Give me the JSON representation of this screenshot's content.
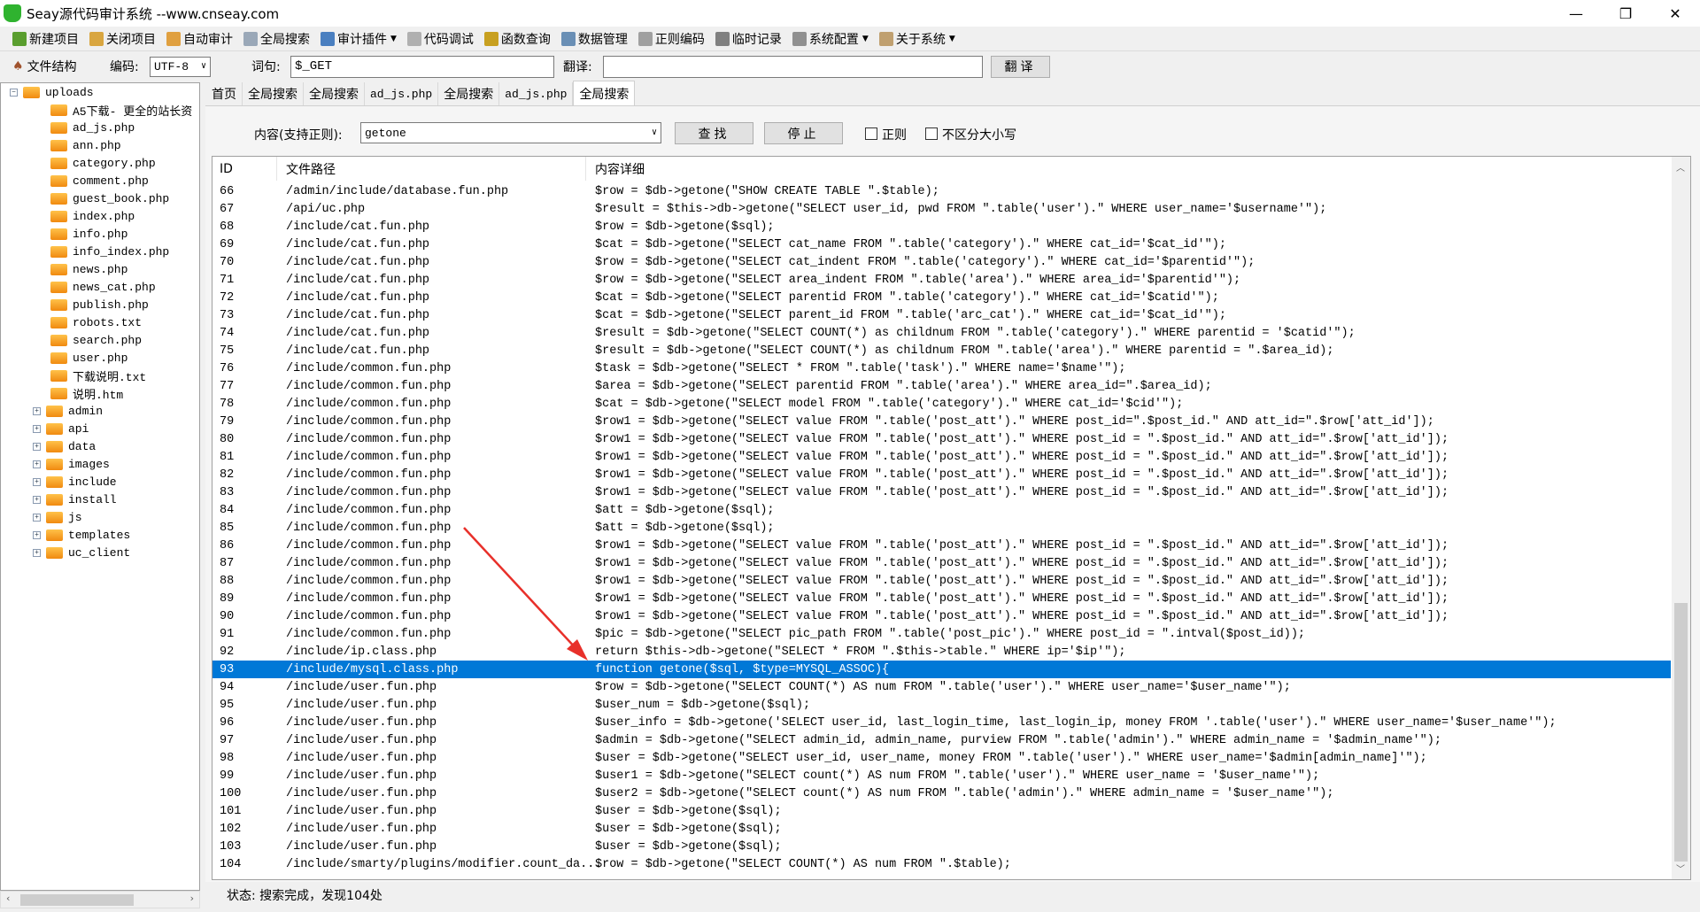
{
  "window": {
    "title": "Seay源代码审计系统 --www.cnseay.com",
    "minimize": "—",
    "maximize": "❐",
    "close": "✕"
  },
  "toolbar": [
    {
      "label": "新建项目",
      "icon": "new-project-icon",
      "color": "#5a9e2f"
    },
    {
      "label": "关闭项目",
      "icon": "close-project-icon",
      "color": "#d9a640"
    },
    {
      "label": "自动审计",
      "icon": "auto-audit-icon",
      "color": "#e0a040"
    },
    {
      "label": "全局搜索",
      "icon": "search-icon",
      "color": "#9aa8b8"
    },
    {
      "label": "审计插件",
      "icon": "plugin-icon",
      "color": "#4a7fc0",
      "dropdown": true
    },
    {
      "label": "代码调试",
      "icon": "debug-icon",
      "color": "#b0b0b0"
    },
    {
      "label": "函数查询",
      "icon": "function-search-icon",
      "color": "#c8a020"
    },
    {
      "label": "数据管理",
      "icon": "data-manage-icon",
      "color": "#6a8fb5"
    },
    {
      "label": "正则编码",
      "icon": "regex-icon",
      "color": "#a0a0a0"
    },
    {
      "label": "临时记录",
      "icon": "notes-icon",
      "color": "#808080"
    },
    {
      "label": "系统配置",
      "icon": "gear-icon",
      "color": "#909090",
      "dropdown": true
    },
    {
      "label": "关于系统",
      "icon": "about-icon",
      "color": "#c0a070",
      "dropdown": true
    }
  ],
  "row2": {
    "file_structure": "文件结构",
    "encoding_label": "编码:",
    "encoding_value": "UTF-8",
    "word_label": "词句:",
    "word_value": "$_GET",
    "translate_label": "翻译:",
    "translate_value": "",
    "translate_button": "翻译"
  },
  "tree": {
    "root": "uploads",
    "files": [
      "A5下载- 更全的站长资",
      "ad_js.php",
      "ann.php",
      "category.php",
      "comment.php",
      "guest_book.php",
      "index.php",
      "info.php",
      "info_index.php",
      "news.php",
      "news_cat.php",
      "publish.php",
      "robots.txt",
      "search.php",
      "user.php",
      "下载说明.txt",
      "说明.htm"
    ],
    "folders": [
      "admin",
      "api",
      "data",
      "images",
      "include",
      "install",
      "js",
      "templates",
      "uc_client"
    ]
  },
  "tabs": [
    {
      "label": "首页"
    },
    {
      "label": "全局搜索"
    },
    {
      "label": "全局搜索"
    },
    {
      "label": "ad_js.php",
      "mono": true
    },
    {
      "label": "全局搜索"
    },
    {
      "label": "ad_js.php",
      "mono": true
    },
    {
      "label": "全局搜索",
      "active": true
    }
  ],
  "search": {
    "content_label": "内容(支持正则):",
    "content_value": "getone",
    "find_button": "查找",
    "stop_button": "停止",
    "regex_label": "正则",
    "regex_checked": false,
    "case_label": "不区分大小写",
    "case_checked": false
  },
  "results": {
    "columns": [
      "ID",
      "文件路径",
      "内容详细"
    ],
    "selected_id": "93",
    "selection_color": "#0078d7",
    "rows": [
      [
        "66",
        "/admin/include/database.fun.php",
        "$row = $db->getone(\"SHOW CREATE TABLE \".$table);"
      ],
      [
        "67",
        "/api/uc.php",
        "$result = $this->db->getone(\"SELECT user_id, pwd FROM \".table('user').\" WHERE user_name='$username'\");"
      ],
      [
        "68",
        "/include/cat.fun.php",
        "$row = $db->getone($sql);"
      ],
      [
        "69",
        "/include/cat.fun.php",
        "$cat = $db->getone(\"SELECT cat_name FROM \".table('category').\" WHERE cat_id='$cat_id'\");"
      ],
      [
        "70",
        "/include/cat.fun.php",
        "$row = $db->getone(\"SELECT cat_indent FROM \".table('category').\" WHERE cat_id='$parentid'\");"
      ],
      [
        "71",
        "/include/cat.fun.php",
        "$row = $db->getone(\"SELECT area_indent FROM \".table('area').\" WHERE area_id='$parentid'\");"
      ],
      [
        "72",
        "/include/cat.fun.php",
        "$cat = $db->getone(\"SELECT parentid FROM \".table('category').\" WHERE cat_id='$catid'\");"
      ],
      [
        "73",
        "/include/cat.fun.php",
        "$cat = $db->getone(\"SELECT parent_id FROM \".table('arc_cat').\" WHERE cat_id='$cat_id'\");"
      ],
      [
        "74",
        "/include/cat.fun.php",
        "$result = $db->getone(\"SELECT COUNT(*) as childnum FROM \".table('category').\" WHERE parentid = '$catid'\");"
      ],
      [
        "75",
        "/include/cat.fun.php",
        "$result = $db->getone(\"SELECT COUNT(*) as childnum FROM \".table('area').\" WHERE parentid = \".$area_id);"
      ],
      [
        "76",
        "/include/common.fun.php",
        "$task = $db->getone(\"SELECT * FROM \".table('task').\" WHERE name='$name'\");"
      ],
      [
        "77",
        "/include/common.fun.php",
        "$area = $db->getone(\"SELECT parentid FROM \".table('area').\" WHERE area_id=\".$area_id);"
      ],
      [
        "78",
        "/include/common.fun.php",
        "$cat = $db->getone(\"SELECT model FROM \".table('category').\" WHERE cat_id='$cid'\");"
      ],
      [
        "79",
        "/include/common.fun.php",
        "$row1 = $db->getone(\"SELECT value FROM \".table('post_att').\" WHERE post_id=\".$post_id.\" AND att_id=\".$row['att_id']);"
      ],
      [
        "80",
        "/include/common.fun.php",
        "$row1 = $db->getone(\"SELECT value FROM \".table('post_att').\" WHERE post_id = \".$post_id.\" AND att_id=\".$row['att_id']);"
      ],
      [
        "81",
        "/include/common.fun.php",
        "$row1 = $db->getone(\"SELECT value FROM \".table('post_att').\" WHERE post_id = \".$post_id.\" AND att_id=\".$row['att_id']);"
      ],
      [
        "82",
        "/include/common.fun.php",
        "$row1 = $db->getone(\"SELECT value FROM \".table('post_att').\" WHERE post_id = \".$post_id.\" AND att_id=\".$row['att_id']);"
      ],
      [
        "83",
        "/include/common.fun.php",
        "$row1 = $db->getone(\"SELECT value FROM \".table('post_att').\" WHERE post_id = \".$post_id.\" AND att_id=\".$row['att_id']);"
      ],
      [
        "84",
        "/include/common.fun.php",
        "$att = $db->getone($sql);"
      ],
      [
        "85",
        "/include/common.fun.php",
        "$att = $db->getone($sql);"
      ],
      [
        "86",
        "/include/common.fun.php",
        "$row1 = $db->getone(\"SELECT value FROM \".table('post_att').\" WHERE post_id = \".$post_id.\" AND att_id=\".$row['att_id']);"
      ],
      [
        "87",
        "/include/common.fun.php",
        "$row1 = $db->getone(\"SELECT value FROM \".table('post_att').\" WHERE post_id = \".$post_id.\" AND att_id=\".$row['att_id']);"
      ],
      [
        "88",
        "/include/common.fun.php",
        "$row1 = $db->getone(\"SELECT value FROM \".table('post_att').\" WHERE post_id = \".$post_id.\" AND att_id=\".$row['att_id']);"
      ],
      [
        "89",
        "/include/common.fun.php",
        "$row1 = $db->getone(\"SELECT value FROM \".table('post_att').\" WHERE post_id = \".$post_id.\" AND att_id=\".$row['att_id']);"
      ],
      [
        "90",
        "/include/common.fun.php",
        "$row1 = $db->getone(\"SELECT value FROM \".table('post_att').\" WHERE post_id = \".$post_id.\" AND att_id=\".$row['att_id']);"
      ],
      [
        "91",
        "/include/common.fun.php",
        "$pic = $db->getone(\"SELECT pic_path FROM \".table('post_pic').\" WHERE post_id = \".intval($post_id));"
      ],
      [
        "92",
        "/include/ip.class.php",
        "return $this->db->getone(\"SELECT * FROM \".$this->table.\" WHERE ip='$ip'\");"
      ],
      [
        "93",
        "/include/mysql.class.php",
        "function getone($sql, $type=MYSQL_ASSOC){"
      ],
      [
        "94",
        "/include/user.fun.php",
        "$row = $db->getone(\"SELECT COUNT(*) AS num FROM \".table('user').\" WHERE user_name='$user_name'\");"
      ],
      [
        "95",
        "/include/user.fun.php",
        "$user_num = $db->getone($sql);"
      ],
      [
        "96",
        "/include/user.fun.php",
        "$user_info = $db->getone('SELECT user_id, last_login_time, last_login_ip, money FROM '.table('user').\" WHERE user_name='$user_name'\");"
      ],
      [
        "97",
        "/include/user.fun.php",
        "$admin = $db->getone(\"SELECT admin_id, admin_name, purview FROM \".table('admin').\" WHERE admin_name = '$admin_name'\");"
      ],
      [
        "98",
        "/include/user.fun.php",
        "$user = $db->getone(\"SELECT user_id, user_name, money FROM \".table('user').\" WHERE user_name='$admin[admin_name]'\");"
      ],
      [
        "99",
        "/include/user.fun.php",
        "$user1 = $db->getone(\"SELECT count(*) AS num FROM \".table('user').\" WHERE user_name = '$user_name'\");"
      ],
      [
        "100",
        "/include/user.fun.php",
        "$user2 = $db->getone(\"SELECT count(*) AS num FROM \".table('admin').\" WHERE admin_name = '$user_name'\");"
      ],
      [
        "101",
        "/include/user.fun.php",
        "$user = $db->getone($sql);"
      ],
      [
        "102",
        "/include/user.fun.php",
        "$user = $db->getone($sql);"
      ],
      [
        "103",
        "/include/user.fun.php",
        "$user = $db->getone($sql);"
      ],
      [
        "104",
        "/include/smarty/plugins/modifier.count_da...",
        "$row = $db->getone(\"SELECT COUNT(*) AS num FROM \".$table);"
      ]
    ]
  },
  "status": {
    "text": "状态: 搜索完成，发现104处"
  },
  "annotation": {
    "arrow_color": "#e8302a"
  }
}
